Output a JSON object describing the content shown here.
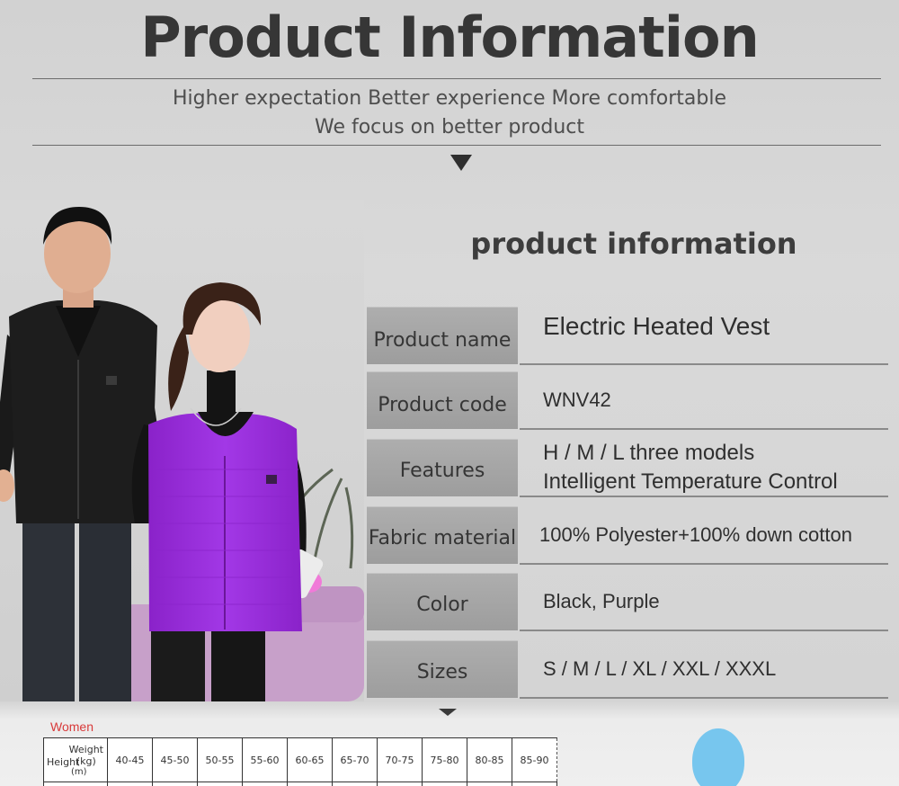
{
  "header": {
    "title": "Product Information",
    "tagline_line1": "Higher expectation  Better experience  More comfortable",
    "tagline_line2": "We focus on better product"
  },
  "section": {
    "title": "product information"
  },
  "product_info": [
    {
      "label": "Product name",
      "value_lines": [
        "Electric Heated Vest"
      ]
    },
    {
      "label": "Product code",
      "value_lines": [
        "WNV42"
      ]
    },
    {
      "label": "Features",
      "value_lines": [
        "H / M / L three models",
        "Intelligent Temperature Control"
      ]
    },
    {
      "label": "Fabric material",
      "value_lines": [
        "100% Polyester+100% down cotton"
      ]
    },
    {
      "label": "Color",
      "value_lines": [
        "Black, Purple"
      ]
    },
    {
      "label": "Sizes",
      "value_lines": [
        "S / M / L / XL / XXL / XXXL"
      ]
    }
  ],
  "size_chart": {
    "group_label": "Women",
    "corner_weight": "Weight",
    "corner_weight_unit": "(kg)",
    "corner_height": "Height",
    "corner_height_unit": "(m)",
    "weight_columns": [
      "40-45",
      "45-50",
      "50-55",
      "55-60",
      "60-65",
      "65-70",
      "70-75",
      "75-80",
      "80-85",
      "85-90"
    ]
  },
  "colors": {
    "vest_black": "#1e1e1e",
    "vest_purple": "#9b2ed8",
    "background": "#d6d6d6",
    "label_cell": "#a8a8a8",
    "women_label": "#d83a3a",
    "balloon": "#77c6ee"
  }
}
